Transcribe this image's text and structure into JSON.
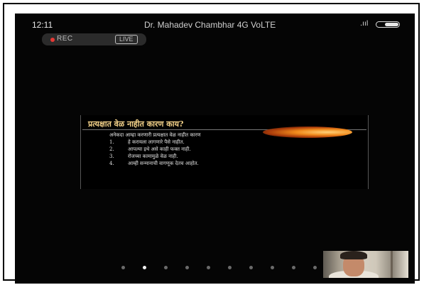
{
  "statusbar": {
    "time": "12:11",
    "caller": "Dr. Mahadev Chambhar",
    "network": "4G VoLTE",
    "signal_icon": "signal-bars-icon",
    "battery_icon": "battery-icon"
  },
  "recording": {
    "rec_label": "REC",
    "live_label": "LIVE"
  },
  "slide": {
    "title": "प्रत्यक्षात वेळ नाहीत कारण काय?",
    "intro": "अनेकदा आम्हा करणारी प्रत्यक्षात वेळ नाहीत कारण",
    "items": [
      {
        "num": "1.",
        "text": "हे करायला लागणारे पैसे नाहीत."
      },
      {
        "num": "2.",
        "text": "आपल्या इथे असे काही फक्त नाही."
      },
      {
        "num": "3.",
        "text": "रोजच्या कामामुळे वेळ नाही."
      },
      {
        "num": "4.",
        "text": "आम्ही सन्मानाची वागणूक देतच आहोत."
      }
    ]
  },
  "pager": {
    "count": 10,
    "active_index": 1
  },
  "pip": {
    "icon": "webcam-thumbnail"
  }
}
